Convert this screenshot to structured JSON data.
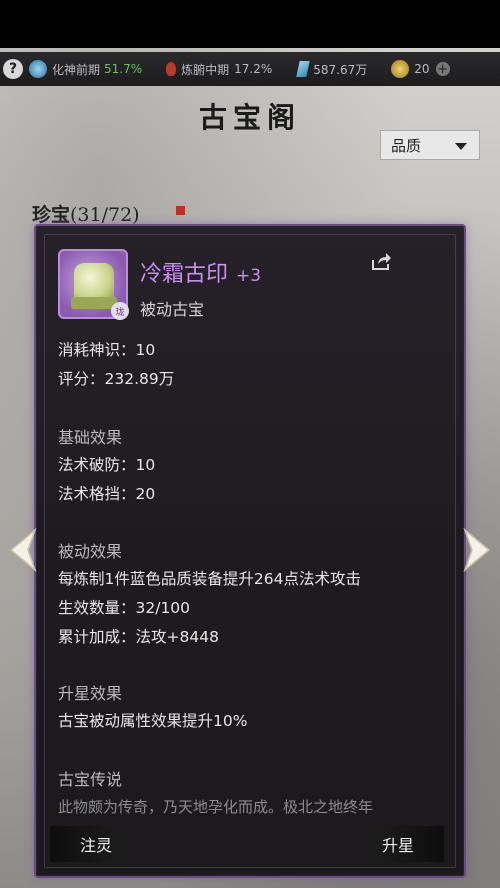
{
  "status_bar": {
    "help_glyph": "?",
    "realm": "化神前期",
    "realm_progress": "51.7%",
    "body_realm": "炼腑中期",
    "body_progress": "17.2%",
    "spirit_stones": "587.67万",
    "currency": "20",
    "plus_glyph": "+"
  },
  "page": {
    "title": "古宝阁",
    "filter_label": "品质"
  },
  "collection": {
    "label": "珍宝",
    "count": "(31/72)"
  },
  "item": {
    "name": "冷霜古印",
    "level": "+3",
    "type": "被动古宝",
    "badge": "珑",
    "cost_line": "消耗神识：10",
    "score_line": "评分：232.89万",
    "basic_title": "基础效果",
    "basic_effects": [
      "法术破防：10",
      "法术格挡：20"
    ],
    "passive_title": "被动效果",
    "passive_effects": [
      "每炼制1件蓝色品质装备提升264点法术攻击",
      "生效数量：32/100",
      "累计加成：法攻+8448"
    ],
    "star_title": "升星效果",
    "star_effect": "古宝被动属性效果提升10%",
    "lore_title": "古宝传说",
    "lore_text": "此物颇为传奇，乃天地孕化而成。极北之地终年"
  },
  "buttons": {
    "infuse": "注灵",
    "upgrade_star": "升星"
  },
  "colors": {
    "item_name": "#c88ef0",
    "card_border": "#6a4c82",
    "progress_green": "#6fbf5f"
  },
  "icons": [
    "help-icon",
    "realm-icon",
    "flame-icon",
    "crystal-icon",
    "coin-icon",
    "plus-icon",
    "share-icon",
    "chevron-left-icon",
    "chevron-right-icon"
  ]
}
